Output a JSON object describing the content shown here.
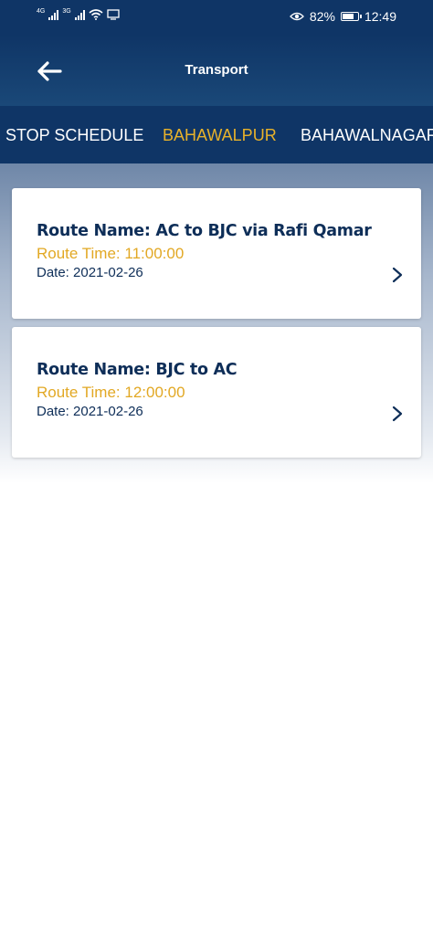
{
  "status_bar": {
    "net_1": "4G",
    "net_2": "3G",
    "battery": "82%",
    "battery_level": 0.82,
    "time": "12:49",
    "icons": [
      "signal-icon",
      "wifi-icon",
      "screen-cast-icon",
      "eye-comfort-icon",
      "battery-icon"
    ]
  },
  "header": {
    "title": "Transport",
    "back_icon": "back-arrow-icon"
  },
  "tabs": [
    {
      "label": "STOP SCHEDULE",
      "active": false
    },
    {
      "label": "BAHAWALPUR",
      "active": true
    },
    {
      "label": "BAHAWALNAGAR",
      "active": false
    }
  ],
  "routes": [
    {
      "name": "Route Name: AC to BJC via Rafi Qamar",
      "time": "Route Time: 11:00:00",
      "date": "Date: 2021-02-26"
    },
    {
      "name": "Route Name: BJC to AC",
      "time": "Route Time: 12:00:00",
      "date": "Date: 2021-02-26"
    }
  ],
  "colors": {
    "primary": "#0f3566",
    "accent": "#e8b22a",
    "text_dark": "#0e2e58"
  }
}
